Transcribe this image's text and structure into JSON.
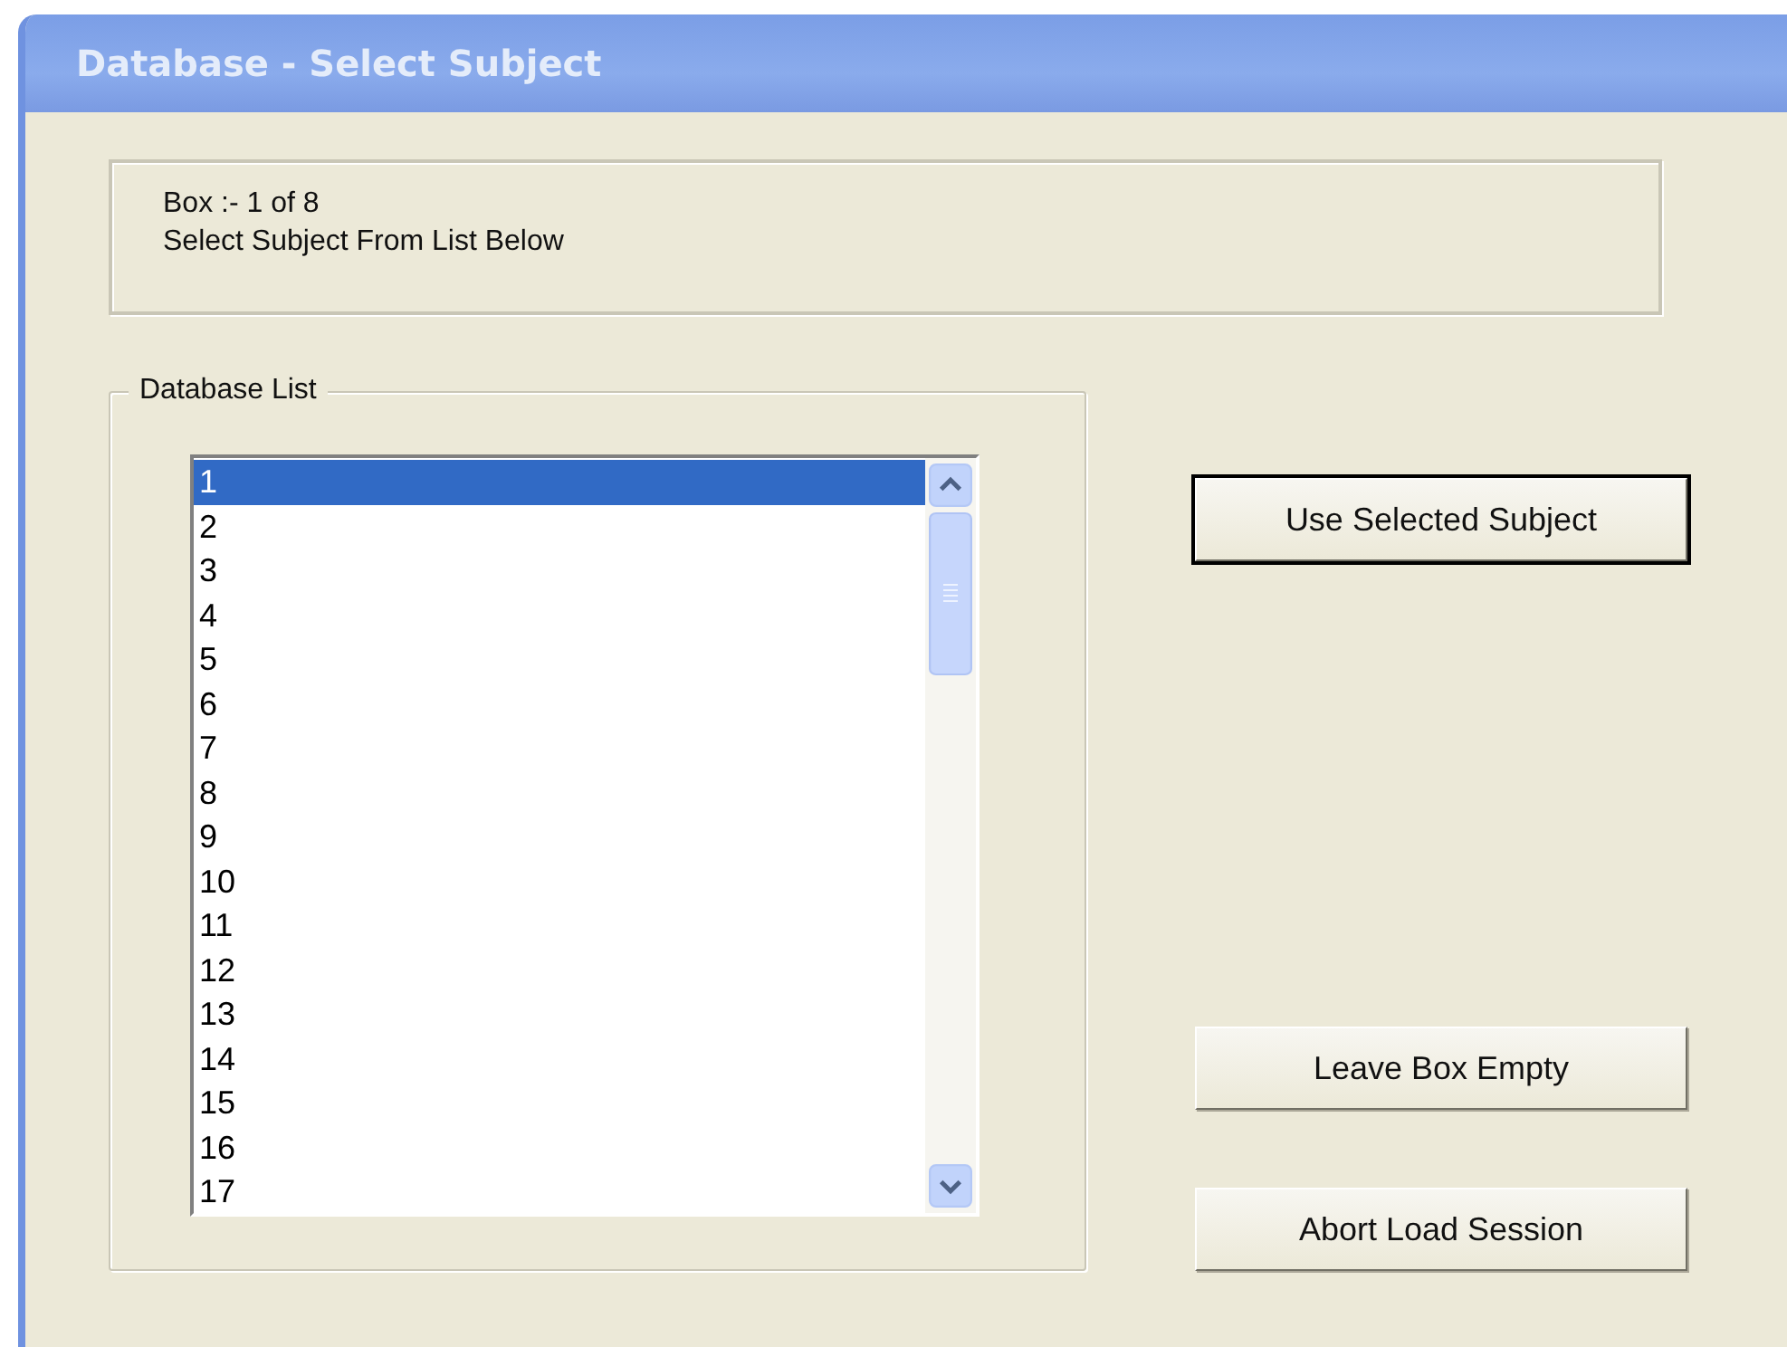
{
  "window": {
    "title": "Database - Select Subject"
  },
  "info": {
    "lines": [
      "Box :- 1 of 8",
      "Select Subject From List Below"
    ]
  },
  "database_list": {
    "title": "Database List",
    "items": [
      {
        "label": "1",
        "selected": true
      },
      {
        "label": "2",
        "selected": false
      },
      {
        "label": "3",
        "selected": false
      },
      {
        "label": "4",
        "selected": false
      },
      {
        "label": "5",
        "selected": false
      },
      {
        "label": "6",
        "selected": false
      },
      {
        "label": "7",
        "selected": false
      },
      {
        "label": "8",
        "selected": false
      },
      {
        "label": "9",
        "selected": false
      },
      {
        "label": "10",
        "selected": false
      },
      {
        "label": "11",
        "selected": false
      },
      {
        "label": "12",
        "selected": false
      },
      {
        "label": "13",
        "selected": false
      },
      {
        "label": "14",
        "selected": false
      },
      {
        "label": "15",
        "selected": false
      },
      {
        "label": "16",
        "selected": false
      },
      {
        "label": "17",
        "selected": false
      }
    ]
  },
  "buttons": [
    {
      "label": "Use Selected Subject",
      "default": true
    },
    {
      "label": "Leave Box Empty",
      "default": false
    },
    {
      "label": "Abort Load Session",
      "default": false
    }
  ]
}
